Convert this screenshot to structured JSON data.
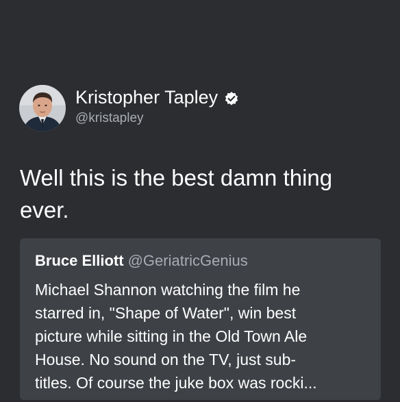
{
  "tweet": {
    "author": {
      "display_name": "Kristopher Tapley",
      "handle": "@kristapley",
      "verified": true,
      "avatar_icon": "profile-photo"
    },
    "text": "Well this is the best damn thing ever."
  },
  "quoted_tweet": {
    "display_name": "Bruce Elliott",
    "handle": "@GeriatricGenius",
    "text": "Michael Shannon watching the film he\nstarred in, \"Shape of Water\", win best\npicture while sitting in the Old Town Ale\nHouse. No sound on the TV, just sub-\ntitles. Of course the juke box was rocki..."
  },
  "colors": {
    "background": "#2b2d31",
    "card": "#3e4146",
    "secondary_text": "#a9adb3",
    "verified_badge": "#ffffff"
  }
}
